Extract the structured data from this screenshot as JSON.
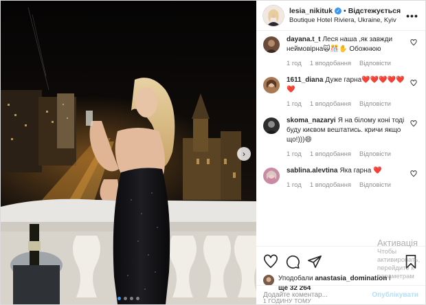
{
  "post": {
    "username": "lesia_nikituk",
    "separator": "•",
    "follow_label": "Відстежується",
    "location": "Boutique Hotel Riviera, Ukraine, Kyiv",
    "more_label": "•••",
    "next_glyph": "›",
    "carousel": {
      "count": 4,
      "active_index": 0
    }
  },
  "comments": [
    {
      "user": "dayana.t_t",
      "text": "Леся наша ,як завжди неймовірна🙀🎊✋ Обожнюю",
      "time": "1 год",
      "reply": "1 вподобання",
      "reply_label": "Відповісти",
      "avatar_color": "#6b4b3a"
    },
    {
      "user": "1611_diana",
      "text": "Дуже гарна❤️❤️❤️❤️❤️❤️",
      "time": "1 год",
      "reply": "1 вподобання",
      "reply_label": "Відповісти",
      "avatar_color": "#a77a55"
    },
    {
      "user": "skoma_nazaryi",
      "text": "Я на білому коні тоді буду києвом вештатись. кричи якщо що!)))😄",
      "time": "1 год",
      "reply": "1 вподобання",
      "reply_label": "Відповісти",
      "avatar_color": "#2d2d2d"
    },
    {
      "user": "sablina.alevtina",
      "text": "Яка гарна ❤️",
      "time": "1 год",
      "reply": "1 вподобання",
      "reply_label": "Відповісти",
      "avatar_color": "#c98aa3"
    }
  ],
  "likes": {
    "prefix": "Уподобали",
    "user": "anastasia_domination",
    "middle": "і",
    "more": "ще 32 264"
  },
  "time_ago": "1 ГОДИНУ ТОМУ",
  "add_comment": {
    "placeholder": "Додайте коментар...",
    "publish_label": "Опублікувати"
  },
  "watermark": {
    "title": "Активація",
    "line": "Чтобы активировать, перейдите к параметрам"
  },
  "colors": {
    "link_blue": "#3897f0",
    "heart_red": "#ed4956",
    "muted": "#8e8e8e"
  },
  "icons": [
    "heart-icon",
    "comment-icon",
    "share-icon",
    "bookmark-icon",
    "more-icon",
    "verified-icon",
    "chevron-right-icon"
  ]
}
